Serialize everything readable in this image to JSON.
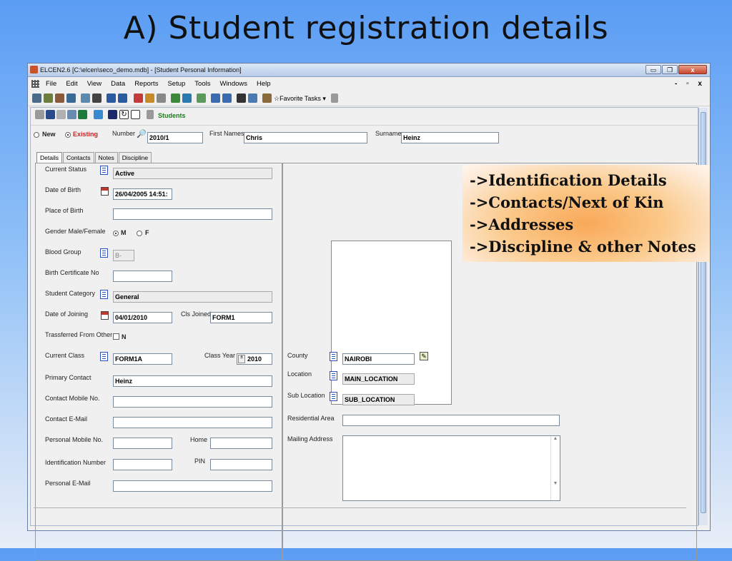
{
  "slide": {
    "title": "A) Student registration details"
  },
  "window": {
    "title": "ELCEN2.6 [C:\\elcen\\seco_demo.mdb] - [Student Personal Information]",
    "buttons": {
      "minimize": "▭",
      "restore": "❐",
      "close": "x"
    },
    "mdi_buttons": "- ▫ x"
  },
  "menu": [
    "File",
    "Edit",
    "View",
    "Data",
    "Reports",
    "Setup",
    "Tools",
    "Windows",
    "Help"
  ],
  "toolbar": {
    "favorite_tasks": "Favorite Tasks ▾"
  },
  "form_toolbar": {
    "students_label": "Students"
  },
  "mode": {
    "new": "New",
    "existing": "Existing",
    "selected": "existing"
  },
  "header_fields": {
    "number_label": "Number",
    "number_value": "2010/1",
    "first_names_label": "First Names",
    "first_names_value": "Chris",
    "surname_label": "Surname",
    "surname_value": "Heinz"
  },
  "tabs": [
    "Details",
    "Contacts",
    "Notes",
    "Discipline"
  ],
  "details": {
    "current_status": {
      "label": "Current Status",
      "value": "Active"
    },
    "date_of_birth": {
      "label": "Date of Birth",
      "value": "26/04/2005 14:51:"
    },
    "place_of_birth": {
      "label": "Place of Birth",
      "value": ""
    },
    "gender": {
      "label": "Gender Male/Female",
      "male": "M",
      "female": "F",
      "selected": "M"
    },
    "blood_group": {
      "label": "Blood Group",
      "value": "B-"
    },
    "birth_certificate": {
      "label": "Birth Certificate No",
      "value": ""
    },
    "student_category": {
      "label": "Student Category",
      "value": "General"
    },
    "date_of_joining": {
      "label": "Date of Joining",
      "value": "04/01/2010"
    },
    "cls_joined": {
      "label": "Cls Joined",
      "value": "FORM1"
    },
    "transferred_from_other": {
      "label": "Trassferred From Other",
      "value": "N"
    },
    "current_class": {
      "label": "Current Class",
      "value": "FORM1A"
    },
    "class_year": {
      "label": "Class Year",
      "value": "2010"
    },
    "primary_contact": {
      "label": "Primary Contact",
      "value": "Heinz"
    },
    "contact_mobile": {
      "label": "Contact Mobile No.",
      "value": ""
    },
    "contact_email": {
      "label": "Contact E-Mail",
      "value": ""
    },
    "personal_mobile": {
      "label": "Personal Mobile No.",
      "value": ""
    },
    "home": {
      "label": "Home",
      "value": ""
    },
    "identification_number": {
      "label": "Identification Number",
      "value": ""
    },
    "pin": {
      "label": "PIN",
      "value": ""
    },
    "personal_email": {
      "label": "Personal E-Mail",
      "value": ""
    }
  },
  "address": {
    "county": {
      "label": "County",
      "value": "NAIROBI"
    },
    "location": {
      "label": "Location",
      "value": "MAIN_LOCATION"
    },
    "sub_location": {
      "label": "Sub Location",
      "value": "SUB_LOCATION"
    },
    "residential_area": {
      "label": "Residential Area",
      "value": ""
    },
    "mailing_address": {
      "label": "Mailing Address",
      "value": ""
    }
  },
  "callout": [
    "->Identification Details",
    "->Contacts/Next of Kin",
    "->Addresses",
    "->Discipline & other Notes"
  ],
  "colors": {
    "students_label": "#1f7a1f",
    "existing_label": "#d02020",
    "callout_center": "#f9a857"
  }
}
